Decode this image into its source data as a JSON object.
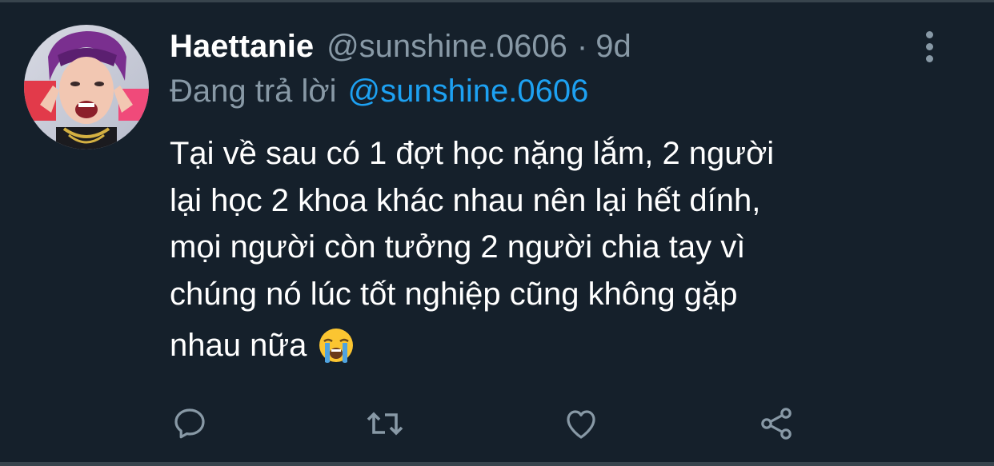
{
  "tweet": {
    "display_name": "Haettanie",
    "handle": "@sunshine.0606",
    "separator": "·",
    "time": "9d",
    "reply_prefix": "Đang trả lời",
    "reply_to": "@sunshine.0606",
    "text_lines": [
      "Tại về sau có 1 đợt học nặng lắm, 2 người",
      "lại học 2 khoa khác nhau nên lại hết dính,",
      "mọi người còn tưởng 2 người chia tay vì",
      "chúng nó lúc tốt nghiệp cũng không gặp",
      "nhau nữa"
    ],
    "emoji": "loudly-crying-face"
  },
  "actions": [
    {
      "name": "reply",
      "icon": "comment-icon"
    },
    {
      "name": "retweet",
      "icon": "retweet-icon"
    },
    {
      "name": "like",
      "icon": "heart-icon"
    },
    {
      "name": "share",
      "icon": "share-icon"
    }
  ],
  "colors": {
    "background": "#15202b",
    "primary_text": "#ffffff",
    "secondary_text": "#8899a6",
    "accent": "#1da1f2",
    "divider": "#38444d"
  }
}
